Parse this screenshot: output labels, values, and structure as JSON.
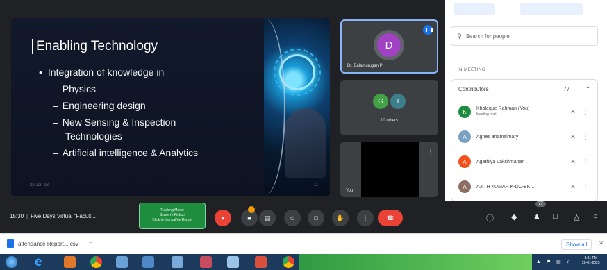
{
  "slide": {
    "title": "Enabling Technology",
    "bullets": [
      {
        "level": 0,
        "text": "Integration of knowledge in"
      },
      {
        "level": 1,
        "text": "Physics"
      },
      {
        "level": 1,
        "text": "Engineering design"
      },
      {
        "level": 1,
        "text": "New Sensing & Inspection"
      },
      {
        "level": 2,
        "text": "Technologies"
      },
      {
        "level": 1,
        "text": "Artificial intelligence & Analytics"
      }
    ],
    "footer_left": "20-Jan-23",
    "footer_right": "11"
  },
  "tiles": {
    "active": {
      "avatar_letter": "D",
      "name": "Dr. Balamurugan P"
    },
    "group": {
      "letters": [
        "G",
        "T"
      ],
      "label": "10 others"
    },
    "third": {
      "name": "You"
    }
  },
  "people_panel": {
    "search_placeholder": "Search for people",
    "in_meeting_label": "IN MEETING",
    "contributors_label": "Contributors",
    "contributors_count": "77",
    "people": [
      {
        "initial": "K",
        "name": "Khaleque Rahman (You)",
        "sub": "Meeting host",
        "color": "#1e8e3e"
      },
      {
        "initial": "A",
        "name": "Agnes anamalmary",
        "sub": "",
        "color": "#7aa0c2"
      },
      {
        "initial": "A",
        "name": "Agathiya Lakshmanan",
        "sub": "",
        "color": "#f4511e"
      },
      {
        "initial": "A",
        "name": "AJITH KUMAR K-DC-BK...",
        "sub": "",
        "color": "#8d6e63"
      }
    ]
  },
  "bottom_bar": {
    "time": "15:30",
    "meeting_title": "Five Days Virtual \"Facult...",
    "tracking_lines": [
      "Tracking Mode:",
      "Screen's Pickup",
      "Click to Manual/de Report"
    ],
    "people_count": "77"
  },
  "download_bar": {
    "file": "attendance Report....csv",
    "show_all": "Show all"
  },
  "taskbar": {
    "time": "3:31 PM",
    "date": "20-01-2023"
  },
  "colors": {
    "meet_bg": "#202124",
    "leave_red": "#ea4335",
    "active_border": "#8ab4f8",
    "tracking_green": "#1e8e3e"
  }
}
